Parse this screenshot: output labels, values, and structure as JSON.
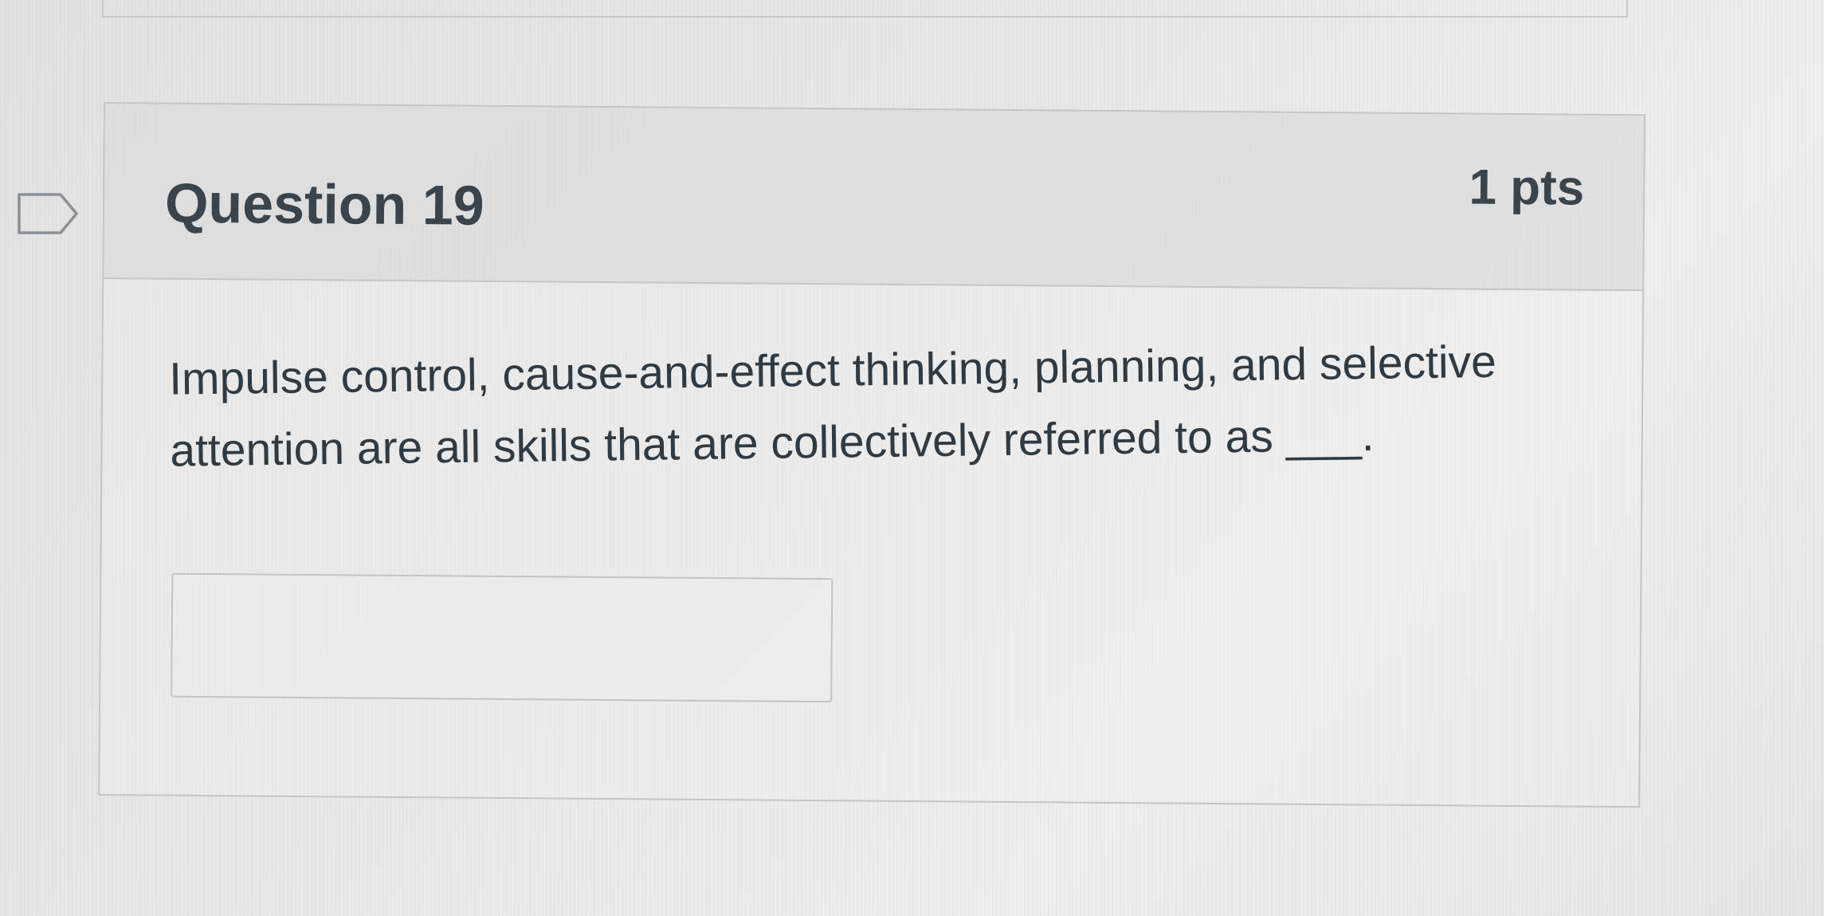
{
  "question": {
    "title": "Question 19",
    "points": "1 pts",
    "text": "Impulse control, cause-and-effect thinking, planning, and selective attention are all skills that are collectively referred to as ___.",
    "answer_value": "",
    "answer_placeholder": ""
  },
  "icons": {
    "flag": "flag-question-icon"
  },
  "colors": {
    "header_background": "#d6d6d6",
    "border": "#c5c5c5",
    "text": "#2d3b45"
  }
}
